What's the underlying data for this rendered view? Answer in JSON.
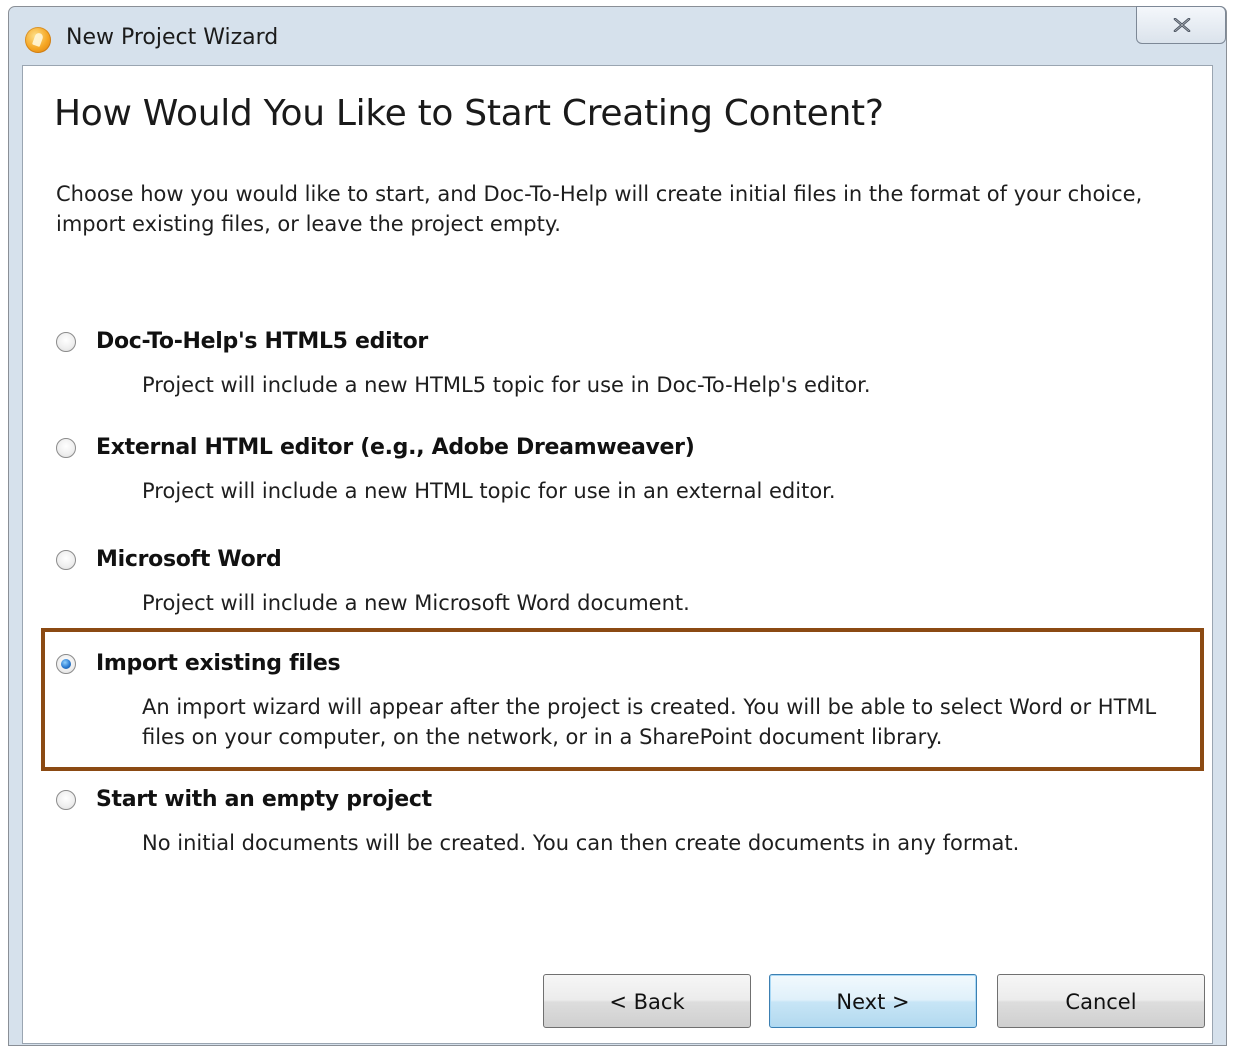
{
  "window": {
    "title": "New Project Wizard",
    "close_glyph": "✕"
  },
  "page": {
    "heading": "How Would You Like to Start Creating Content?",
    "intro": "Choose how you would like to start, and Doc-To-Help will create initial files in the format of your choice, import existing files, or leave the project empty."
  },
  "options": [
    {
      "label": "Doc-To-Help's HTML5 editor",
      "description": "Project will include a new HTML5 topic for use in Doc-To-Help's editor.",
      "selected": false
    },
    {
      "label": "External HTML editor (e.g., Adobe Dreamweaver)",
      "description": "Project will include a new HTML topic for use in an external editor.",
      "selected": false
    },
    {
      "label": "Microsoft Word",
      "description": "Project will include a new Microsoft Word document.",
      "selected": false
    },
    {
      "label": "Import existing files",
      "description": "An import wizard will appear after the project is created. You will be able to select Word or HTML files on your computer, on the network, or in a SharePoint document library.",
      "selected": true
    },
    {
      "label": "Start with an empty project",
      "description": "No initial documents will be created. You can then create documents in any format.",
      "selected": false
    }
  ],
  "buttons": {
    "back": "< Back",
    "next": "Next >",
    "cancel": "Cancel"
  },
  "colors": {
    "highlight_border": "#8b4a13",
    "selected_radio": "#2a7bd2",
    "default_button_border": "#3c7fb1"
  }
}
